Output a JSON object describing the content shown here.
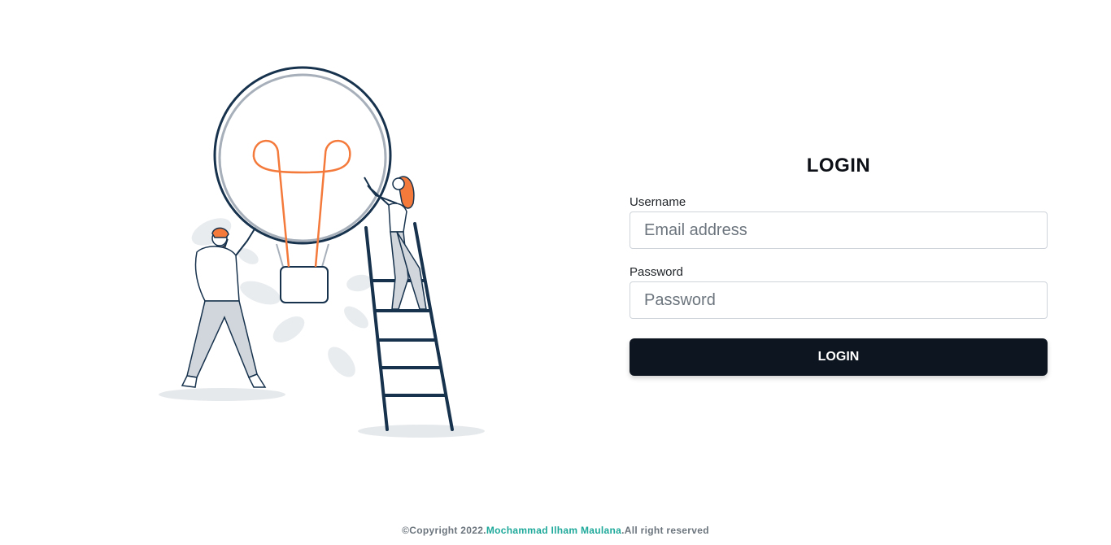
{
  "login": {
    "title": "LOGIN",
    "username_label": "Username",
    "username_placeholder": "Email address",
    "password_label": "Password",
    "password_placeholder": "Password",
    "button_label": "LOGIN"
  },
  "footer": {
    "prefix": "©Copyright 2022.",
    "author": "Mochammad Ilham Maulana",
    "suffix": ".All right reserved"
  },
  "colors": {
    "accent": "#1ea99a",
    "button": "#0d1620",
    "illustration_navy": "#17324d",
    "illustration_orange": "#f47a3c"
  }
}
